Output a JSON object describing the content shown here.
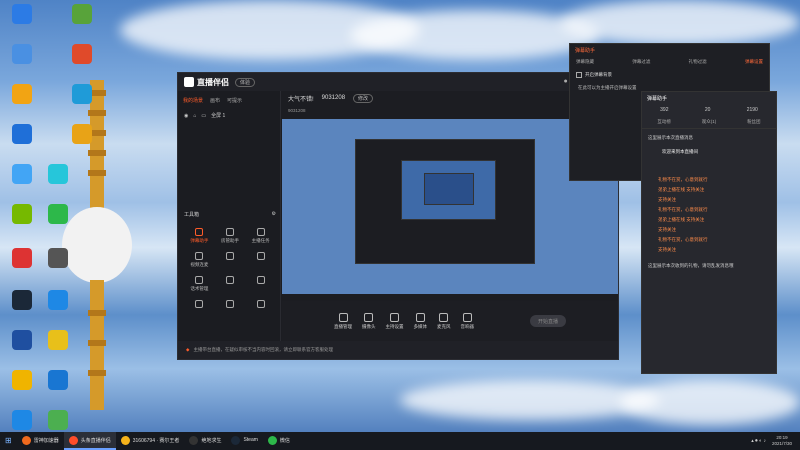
{
  "desktop": {
    "icons": [
      {
        "label": "",
        "color": "#2c7be5"
      },
      {
        "label": "",
        "color": "#58a33a"
      },
      {
        "label": "",
        "color": "#4a90e2"
      },
      {
        "label": "",
        "color": "#e04a2a"
      },
      {
        "label": "",
        "color": "#f2a413"
      },
      {
        "label": "",
        "color": "#1f9bd8"
      },
      {
        "label": "",
        "color": "#1f6fd8"
      },
      {
        "label": "",
        "color": "#e8a317"
      },
      {
        "label": "",
        "color": "#42a5f5"
      },
      {
        "label": "",
        "color": "#26c6da"
      },
      {
        "label": "",
        "color": "#76b900"
      },
      {
        "label": "",
        "color": "#2db84a"
      },
      {
        "label": "",
        "color": "#d33"
      },
      {
        "label": "",
        "color": "#555"
      },
      {
        "label": "",
        "color": "#1b2838"
      },
      {
        "label": "",
        "color": "#1e88e5"
      },
      {
        "label": "",
        "color": "#1f4fa0"
      },
      {
        "label": "",
        "color": "#e8c01a"
      },
      {
        "label": "",
        "color": "#f0b400"
      },
      {
        "label": "",
        "color": "#1976d2"
      },
      {
        "label": "",
        "color": "#1e88e5"
      },
      {
        "label": "",
        "color": "#4caf50"
      }
    ]
  },
  "app": {
    "title": "直播伴侣",
    "version": "体验",
    "sidebar_tabs": [
      "我的场景",
      "画布",
      "可提示"
    ],
    "scene_label": "全屏 1",
    "tools_title": "工具箱",
    "tools": [
      "弹幕助手",
      "房管助手",
      "主播任务",
      "视频连麦",
      "",
      "",
      "话术管理",
      "",
      "",
      "",
      "",
      ""
    ],
    "header": {
      "left": "大气不错!",
      "id": "9031208",
      "badge": "修改"
    },
    "subheader": "9031208",
    "controls": [
      "直播管理",
      "摄像头",
      "主持设置",
      "多媒体",
      "麦克风",
      "音响器"
    ],
    "start_label": "开始直播",
    "notice": "主播带台直播，在疑似审核不当内容时回滚，请立即联系官方客服处理"
  },
  "danmaku": {
    "title": "弹幕助手",
    "tabs": [
      "弹幕隐藏",
      "弹幕过滤",
      "礼物过滤",
      "弹幕设置"
    ],
    "option": "开启弹幕背景",
    "lines": [
      "在此可以为主播开启弹幕设置",
      "",
      "",
      ""
    ]
  },
  "helper": {
    "title": "弹幕助手",
    "stats": [
      "392",
      "20",
      "2190"
    ],
    "tabs": [
      "互动榜",
      "观众(1)",
      "粉丝团"
    ],
    "system_msg": "这里展示本次直播消息",
    "user_msg": {
      "tag": "",
      "name": "",
      "text": "欢迎来到本直播间"
    },
    "messages": [
      {
        "tag": "",
        "text": "礼物不在赏，心意到就行"
      },
      {
        "tag": "",
        "text": "弟弟上播在线 支持关注"
      },
      {
        "tag": "",
        "text": "支持关注"
      },
      {
        "tag": "",
        "text": "礼物不在赏，心意到就行"
      },
      {
        "tag": "",
        "text": "弟弟上播在线 支持关注"
      },
      {
        "tag": "",
        "text": "支持关注"
      },
      {
        "tag": "",
        "text": "礼物不在赏，心意到就行"
      },
      {
        "tag": "",
        "text": "支持关注"
      }
    ],
    "footer_msg": "这里展示本次收到的礼物，请勿乱发消息哦"
  },
  "taskbar": {
    "tasks": [
      {
        "label": "雷神加速器",
        "color": "#f06a1e",
        "active": false
      },
      {
        "label": "头条直播伴侣",
        "color": "#ff4d2a",
        "active": true
      },
      {
        "label": "31606794 · 赛尔王者",
        "color": "#f5b31b",
        "active": false
      },
      {
        "label": "绝地求生",
        "color": "#333",
        "active": false
      },
      {
        "label": "Steam",
        "color": "#1b2838",
        "active": false
      },
      {
        "label": "微信",
        "color": "#2db84a",
        "active": false
      }
    ],
    "time": "20:19",
    "date": "2021/7/30"
  }
}
